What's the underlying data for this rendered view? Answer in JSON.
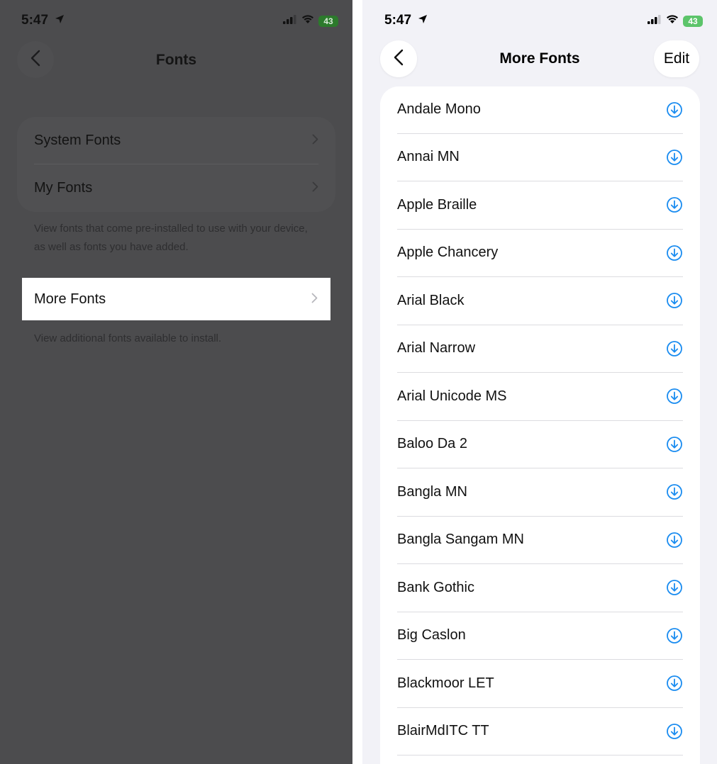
{
  "left_screen": {
    "status": {
      "time": "5:47",
      "battery": "43"
    },
    "title": "Fonts",
    "group_items": [
      {
        "label": "System Fonts"
      },
      {
        "label": "My Fonts"
      }
    ],
    "group_footnote": "View fonts that come pre-installed to use with your device, as well as fonts you have added.",
    "more_fonts": {
      "label": "More Fonts"
    },
    "more_fonts_footnote": "View additional fonts available to install."
  },
  "right_screen": {
    "status": {
      "time": "5:47",
      "battery": "43"
    },
    "title": "More Fonts",
    "edit_label": "Edit",
    "fonts": [
      "Andale Mono",
      "Annai MN",
      "Apple Braille",
      "Apple Chancery",
      "Arial Black",
      "Arial Narrow",
      "Arial Unicode MS",
      "Baloo Da 2",
      "Bangla MN",
      "Bangla Sangam MN",
      "Bank Gothic",
      "Big Caslon",
      "Blackmoor LET",
      "BlairMdITC TT"
    ],
    "accent_color": "#1a8cf0"
  }
}
